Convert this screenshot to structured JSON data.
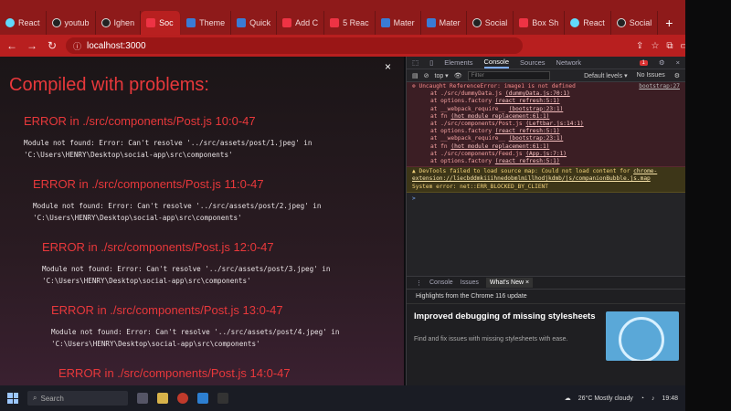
{
  "tabs": [
    {
      "label": "React",
      "icon": "react-icon"
    },
    {
      "label": "youtub",
      "icon": "github-icon"
    },
    {
      "label": "Ighen",
      "icon": "github-icon"
    },
    {
      "label": "Soc",
      "icon": "page-icon",
      "active": true
    },
    {
      "label": "Theme",
      "icon": "mui-icon"
    },
    {
      "label": "Quick",
      "icon": "mui-icon"
    },
    {
      "label": "Add C",
      "icon": "page-icon"
    },
    {
      "label": "5 Reac",
      "icon": "page-icon"
    },
    {
      "label": "Mater",
      "icon": "mui-icon"
    },
    {
      "label": "Mater",
      "icon": "mui-icon"
    },
    {
      "label": "Social",
      "icon": "github-icon"
    },
    {
      "label": "Box Sh",
      "icon": "page-icon"
    },
    {
      "label": "React",
      "icon": "react-icon"
    },
    {
      "label": "Social",
      "icon": "github-icon"
    }
  ],
  "newtab_label": "+",
  "address": {
    "url": "localhost:3000"
  },
  "overlay": {
    "close_label": "×",
    "heading": "Compiled with problems:",
    "errors": [
      {
        "title": "ERROR in ./src/components/Post.js 10:0-47",
        "line1": "Module not found: Error: Can't resolve '../src/assets/post/1.jpeg' in",
        "line2": "'C:\\Users\\HENRY\\Desktop\\social-app\\src\\components'"
      },
      {
        "title": "ERROR in ./src/components/Post.js 11:0-47",
        "line1": "Module not found: Error: Can't resolve '../src/assets/post/2.jpeg' in",
        "line2": "'C:\\Users\\HENRY\\Desktop\\social-app\\src\\components'"
      },
      {
        "title": "ERROR in ./src/components/Post.js 12:0-47",
        "line1": "Module not found: Error: Can't resolve '../src/assets/post/3.jpeg' in",
        "line2": "'C:\\Users\\HENRY\\Desktop\\social-app\\src\\components'"
      },
      {
        "title": "ERROR in ./src/components/Post.js 13:0-47",
        "line1": "Module not found: Error: Can't resolve '../src/assets/post/4.jpeg' in",
        "line2": "'C:\\Users\\HENRY\\Desktop\\social-app\\src\\components'"
      },
      {
        "title": "ERROR in ./src/components/Post.js 14:0-47",
        "line1": "",
        "line2": ""
      }
    ]
  },
  "devtools": {
    "tabs": [
      "Elements",
      "Console",
      "Sources",
      "Network"
    ],
    "active_tab": "Console",
    "error_badge": "1",
    "context": "top",
    "filter_placeholder": "Filter",
    "levels": "Default levels",
    "issues": "No Issues",
    "error": {
      "message": "Uncaught ReferenceError: image1 is not defined",
      "location": "bootstrap:27",
      "stack": [
        {
          "text": "at ./src/dummyData.js",
          "src": "(dummyData.js:70:1)"
        },
        {
          "text": "at options.factory",
          "src": "(react refresh:5:1)"
        },
        {
          "text": "at __webpack_require__",
          "src": "(bootstrap:23:1)"
        },
        {
          "text": "at fn",
          "src": "(hot module replacement:61:1)"
        },
        {
          "text": "at ./src/components/Post.js",
          "src": "(Leftbar.js:14:1)"
        },
        {
          "text": "at options.factory",
          "src": "(react refresh:5:1)"
        },
        {
          "text": "at __webpack_require__",
          "src": "(bootstrap:23:1)"
        },
        {
          "text": "at fn",
          "src": "(hot module replacement:61:1)"
        },
        {
          "text": "at ./src/components/Feed.js",
          "src": "(App.js:7:1)"
        },
        {
          "text": "at options.factory",
          "src": "(react refresh:5:1)"
        }
      ]
    },
    "warning": {
      "text": "DevTools failed to load source map: Could not load content for",
      "link": "chrome-extension://liecbddmkiiihnedobmlmillhodjkdmb/js/companionBubble.js.map",
      "system": "System error: net::ERR_BLOCKED_BY_CLIENT"
    },
    "prompt": ">",
    "drawer": {
      "tabs": [
        "Console",
        "Issues",
        "What's New"
      ],
      "active_tab": "What's New",
      "close_label": "×",
      "highlights": "Highlights from the Chrome 116 update",
      "feature_title": "Improved debugging of missing stylesheets",
      "feature_desc": "Find and fix issues with missing stylesheets with ease."
    }
  },
  "taskbar": {
    "search_placeholder": "Search",
    "weather": "26°C  Mostly cloudy",
    "time": "19:48"
  }
}
